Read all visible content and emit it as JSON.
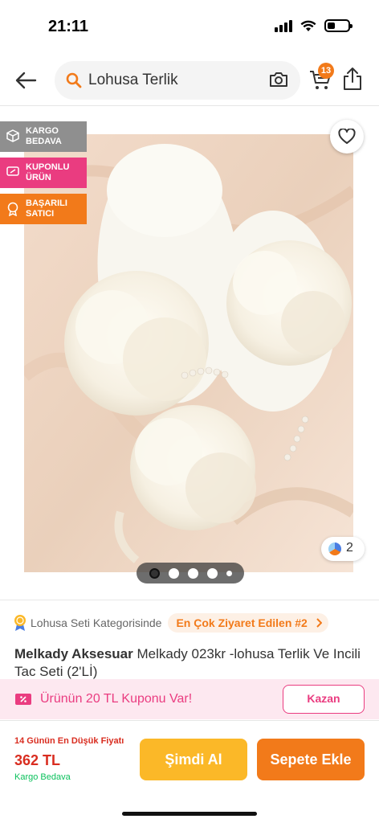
{
  "status_bar": {
    "time": "21:11"
  },
  "search": {
    "query": "Lohusa Terlik"
  },
  "cart": {
    "badge_count": "13"
  },
  "badges": [
    {
      "line1": "KARGO",
      "line2": "BEDAVA"
    },
    {
      "line1": "KUPONLU",
      "line2": "ÜRÜN"
    },
    {
      "line1": "BAŞARILI",
      "line2": "SATICI"
    }
  ],
  "gallery": {
    "photo_count": "2",
    "dot_count": 5,
    "active_dot": 1
  },
  "category": {
    "label": "Lohusa Seti Kategorisinde",
    "chip": "En Çok Ziyaret Edilen #2"
  },
  "product": {
    "brand": "Melkady Aksesuar",
    "name": "Melkady 023kr -lohusa Terlik Ve Incili Tac Seti (2'Lİ)"
  },
  "coupon": {
    "text": "Ürünün 20 TL Kuponu Var!",
    "button": "Kazan"
  },
  "bottom": {
    "lowest_price_note": "14 Günün En Düşük Fiyatı",
    "price": "362 TL",
    "shipping": "Kargo Bedava",
    "buy_now": "Şimdi Al",
    "add_to_cart": "Sepete Ekle"
  },
  "colors": {
    "brand_orange": "#f27a1a",
    "coupon_pink": "#ea3c80",
    "price_red": "#d92d20",
    "buy_yellow": "#fbb828",
    "free_green": "#0bc15c"
  }
}
